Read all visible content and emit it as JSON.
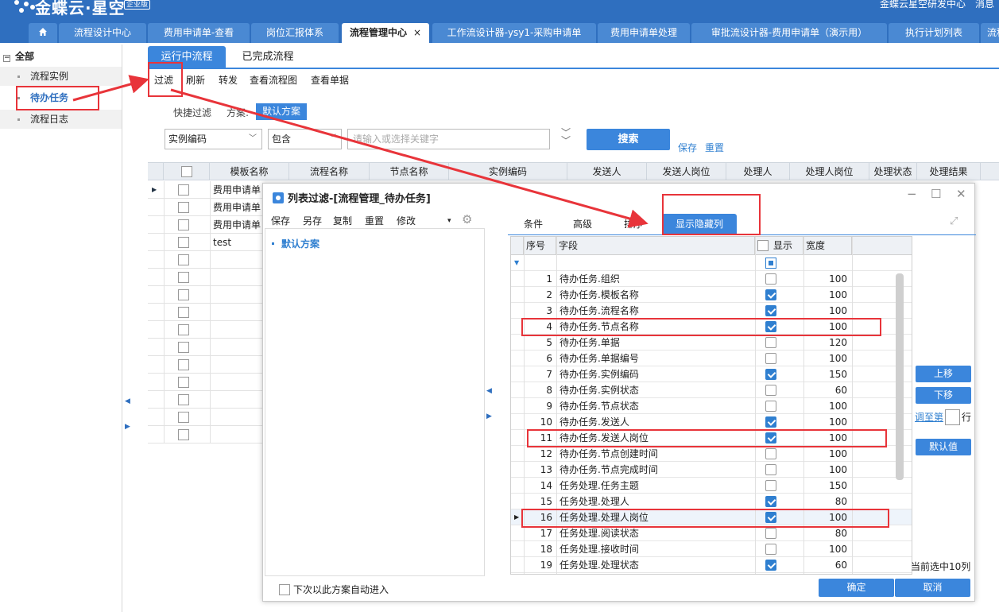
{
  "app": {
    "brand": "金蝶云·星空",
    "edition": "企业版",
    "user": "金蝶云星空研发中心",
    "messages": "消息"
  },
  "tabs": [
    {
      "label": "流程设计中心"
    },
    {
      "label": "费用申请单-查看"
    },
    {
      "label": "岗位汇报体系"
    },
    {
      "label": "流程管理中心"
    },
    {
      "label": "工作流设计器-ysy1-采购申请单"
    },
    {
      "label": "费用申请单处理"
    },
    {
      "label": "审批流设计器-费用申请单（演示用）"
    },
    {
      "label": "执行计划列表"
    },
    {
      "label": "流程"
    }
  ],
  "active_tab_close": "×",
  "tree": {
    "root": "全部",
    "items": [
      {
        "label": "流程实例"
      },
      {
        "label": "待办任务"
      },
      {
        "label": "流程日志"
      }
    ]
  },
  "main_tabs": {
    "running": "运行中流程",
    "done": "已完成流程"
  },
  "toolbar": {
    "filter": "过滤",
    "refresh": "刷新",
    "forward": "转发",
    "view_flow": "查看流程图",
    "view_doc": "查看单据"
  },
  "quick_filter": {
    "label": "快捷过滤",
    "scheme_label": "方案:",
    "scheme_value": "默认方案",
    "field_value": "实例编码",
    "op_value": "包含",
    "keyword_placeholder": "请输入或选择关键字",
    "search": "搜索",
    "save": "保存",
    "reset": "重置"
  },
  "grid": {
    "columns": [
      "模板名称",
      "流程名称",
      "节点名称",
      "实例编码",
      "发送人",
      "发送人岗位",
      "处理人",
      "处理人岗位",
      "处理状态",
      "处理结果"
    ],
    "rows": [
      {
        "template": "费用申请单"
      },
      {
        "template": "费用申请单"
      },
      {
        "template": "费用申请单"
      },
      {
        "template": "test"
      },
      {
        "template": ""
      },
      {
        "template": ""
      },
      {
        "template": ""
      },
      {
        "template": ""
      },
      {
        "template": ""
      },
      {
        "template": ""
      },
      {
        "template": ""
      },
      {
        "template": ""
      },
      {
        "template": ""
      },
      {
        "template": ""
      },
      {
        "template": ""
      }
    ]
  },
  "dialog": {
    "title": "列表过滤-[流程管理_待办任务]",
    "toolbar": {
      "save": "保存",
      "save_as": "另存",
      "copy": "复制",
      "reset": "重置",
      "modify": "修改"
    },
    "scheme": "默认方案",
    "tabs": {
      "condition": "条件",
      "advanced": "高级",
      "sort": "排序",
      "hidden": "显示隐藏列"
    },
    "grid_headers": {
      "no": "序号",
      "field": "字段",
      "show": "显示",
      "width": "宽度"
    },
    "fields": [
      {
        "no": "1",
        "field": "待办任务.组织",
        "show": false,
        "width": "100"
      },
      {
        "no": "2",
        "field": "待办任务.模板名称",
        "show": true,
        "width": "100"
      },
      {
        "no": "3",
        "field": "待办任务.流程名称",
        "show": true,
        "width": "100"
      },
      {
        "no": "4",
        "field": "待办任务.节点名称",
        "show": true,
        "width": "100"
      },
      {
        "no": "5",
        "field": "待办任务.单据",
        "show": false,
        "width": "120"
      },
      {
        "no": "6",
        "field": "待办任务.单据编号",
        "show": false,
        "width": "100"
      },
      {
        "no": "7",
        "field": "待办任务.实例编码",
        "show": true,
        "width": "150"
      },
      {
        "no": "8",
        "field": "待办任务.实例状态",
        "show": false,
        "width": "60"
      },
      {
        "no": "9",
        "field": "待办任务.节点状态",
        "show": false,
        "width": "100"
      },
      {
        "no": "10",
        "field": "待办任务.发送人",
        "show": true,
        "width": "100"
      },
      {
        "no": "11",
        "field": "待办任务.发送人岗位",
        "show": true,
        "width": "100"
      },
      {
        "no": "12",
        "field": "待办任务.节点创建时间",
        "show": false,
        "width": "100"
      },
      {
        "no": "13",
        "field": "待办任务.节点完成时间",
        "show": false,
        "width": "100"
      },
      {
        "no": "14",
        "field": "任务处理.任务主题",
        "show": false,
        "width": "150"
      },
      {
        "no": "15",
        "field": "任务处理.处理人",
        "show": true,
        "width": "80"
      },
      {
        "no": "16",
        "field": "任务处理.处理人岗位",
        "show": true,
        "width": "100"
      },
      {
        "no": "17",
        "field": "任务处理.阅读状态",
        "show": false,
        "width": "80"
      },
      {
        "no": "18",
        "field": "任务处理.接收时间",
        "show": false,
        "width": "100"
      },
      {
        "no": "19",
        "field": "任务处理.处理状态",
        "show": true,
        "width": "60"
      }
    ],
    "move_up": "上移",
    "move_down": "下移",
    "move_to_prefix": "调至第",
    "move_to_suffix": "行",
    "default_value": "默认值",
    "selected_count": "当前选中10列",
    "auto_enter": "下次以此方案自动进入",
    "ok": "确定",
    "cancel": "取消"
  },
  "colors": {
    "brand": "#2f6fbf",
    "accent": "#3b86dc",
    "highlight": "#e8343a"
  }
}
